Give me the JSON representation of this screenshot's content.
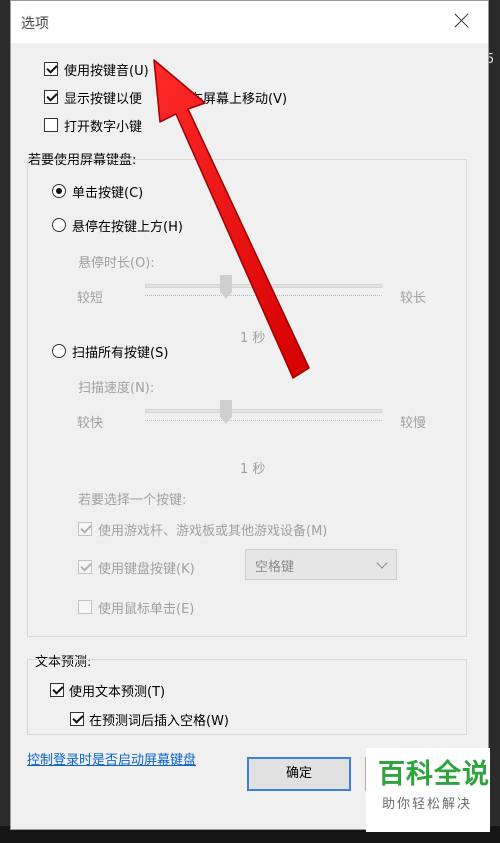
{
  "dialog": {
    "title": "选项",
    "options": {
      "key_sound": "使用按键音(U)",
      "show_keys": "显示按键以便",
      "show_keys_tail": "在屏幕上移动(V)",
      "numpad": "打开数字小键"
    },
    "use_on_screen_keyboard": {
      "heading": "若要使用屏幕键盘:",
      "click_keys": "单击按键(C)",
      "hover_keys": "悬停在按键上方(H)",
      "hover_duration_label": "悬停时长(O):",
      "hover_short": "较短",
      "hover_long": "较长",
      "hover_value": "1 秒",
      "scan_keys": "扫描所有按键(S)",
      "scan_speed_label": "扫描速度(N):",
      "scan_fast": "较快",
      "scan_slow": "较慢",
      "scan_value": "1 秒",
      "choose_key_label": "若要选择一个按键:",
      "joystick": "使用游戏杆、游戏板或其他游戏设备(M)",
      "keyboard_key": "使用键盘按键(K)",
      "keyboard_key_value": "空格键",
      "mouse_click": "使用鼠标单击(E)"
    },
    "text_prediction": {
      "heading": "文本预测:",
      "use_prediction": "使用文本预测(T)",
      "insert_space": "在预测词后插入空格(W)"
    },
    "link": "控制登录时是否启动屏幕键盘",
    "ok_button": "确定"
  },
  "watermark": {
    "title": "百科全说",
    "subtitle": "助你轻松解决"
  },
  "edge_fragment": "5 ·"
}
